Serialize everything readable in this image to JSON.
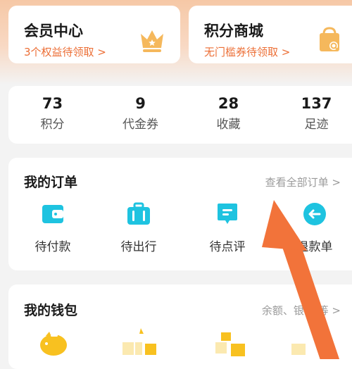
{
  "promo": {
    "member": {
      "title": "会员中心",
      "subtitle": "3个权益待领取 >"
    },
    "points_mall": {
      "title": "积分商城",
      "subtitle": "无门槛券待领取 >"
    }
  },
  "stats": [
    {
      "value": "73",
      "label": "积分"
    },
    {
      "value": "9",
      "label": "代金券"
    },
    {
      "value": "28",
      "label": "收藏"
    },
    {
      "value": "137",
      "label": "足迹"
    }
  ],
  "orders": {
    "title": "我的订单",
    "view_all": "查看全部订单 >",
    "items": [
      {
        "label": "待付款",
        "icon": "wallet-icon"
      },
      {
        "label": "待出行",
        "icon": "suitcase-icon"
      },
      {
        "label": "待点评",
        "icon": "comment-icon"
      },
      {
        "label": "退款单",
        "icon": "refund-icon"
      }
    ]
  },
  "wallet": {
    "title": "我的钱包",
    "link": "余额、银 卡等 >"
  },
  "colors": {
    "accent_orange": "#ec6e35",
    "icon_cyan": "#1ec3e0",
    "icon_yellow": "#f8c120",
    "arrow_orange": "#f2733a"
  }
}
